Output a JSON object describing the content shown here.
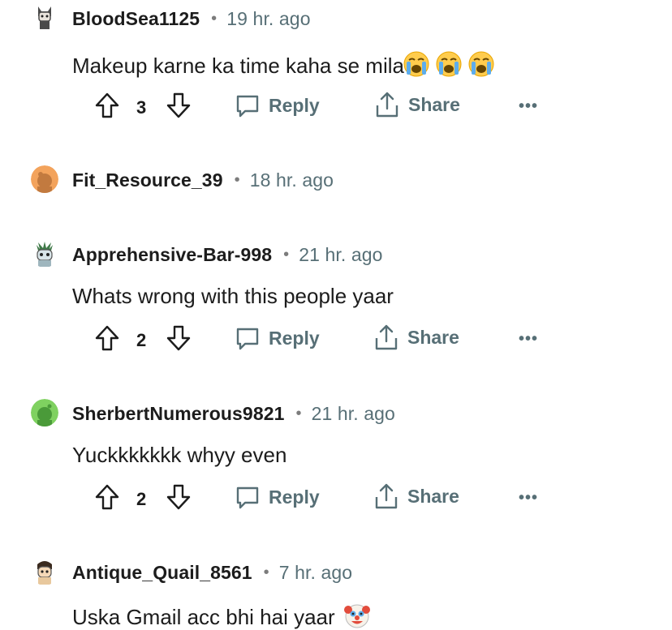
{
  "comments": [
    {
      "username": "BloodSea1125",
      "time": "19 hr. ago",
      "text": "Makeup karne ka time kaha se mila",
      "emoji": [
        "loudly-crying-face",
        "loudly-crying-face",
        "loudly-crying-face"
      ],
      "votes": "3"
    },
    {
      "username": "Fit_Resource_39",
      "time": "18 hr. ago"
    },
    {
      "username": "Apprehensive-Bar-998",
      "time": "21 hr. ago",
      "text": "Whats wrong with this people yaar",
      "votes": "2"
    },
    {
      "username": "SherbertNumerous9821",
      "time": "21 hr. ago",
      "text": "Yuckkkkkkk whyy even",
      "votes": "2"
    },
    {
      "username": "Antique_Quail_8561",
      "time": "7 hr. ago",
      "text": "Uska Gmail acc bhi hai yaar",
      "emoji": [
        "clown-face"
      ]
    }
  ],
  "actions": {
    "reply_label": "Reply",
    "share_label": "Share",
    "more_label": "•••",
    "separator": "•"
  },
  "colors": {
    "text": "#1c1c1c",
    "meta": "#576f76",
    "avatar_orange": "#f3a35c",
    "avatar_green": "#7fd160"
  }
}
